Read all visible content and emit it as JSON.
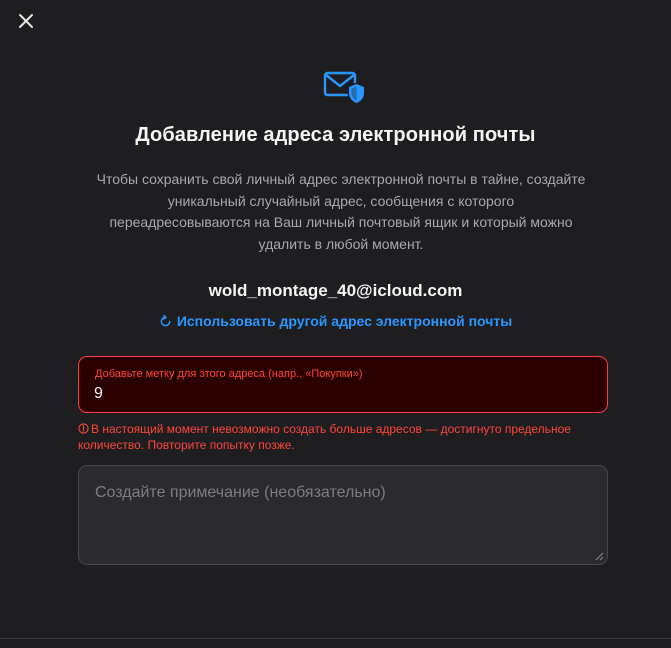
{
  "dialog": {
    "close_icon": "close-icon",
    "hero_icon": "envelope-shield-icon",
    "title": "Добавление адреса электронной почты",
    "description": "Чтобы сохранить свой личный адрес электронной почты в тайне, создайте уникальный случайный адрес, сообщения с которого переадресовываются на Ваш личный почтовый ящик и который можно удалить в любой момент.",
    "email": "wold_montage_40@icloud.com",
    "alt_link_icon": "refresh-icon",
    "alt_link_label": "Использовать другой адрес электронной почты"
  },
  "label_field": {
    "label": "Добавьте метку для этого адреса (напр., «Покупки»)",
    "value": "9"
  },
  "error": {
    "icon": "error-circle-icon",
    "message": "В настоящий момент невозможно создать больше адресов — достигнуто предельное количество. Повторите попытку позже."
  },
  "note_field": {
    "placeholder": "Создайте примечание (необязательно)",
    "value": ""
  },
  "colors": {
    "background": "#1e1e20",
    "accent": "#2997ff",
    "error": "#ff453a",
    "error_field_bg": "#2b0000"
  }
}
